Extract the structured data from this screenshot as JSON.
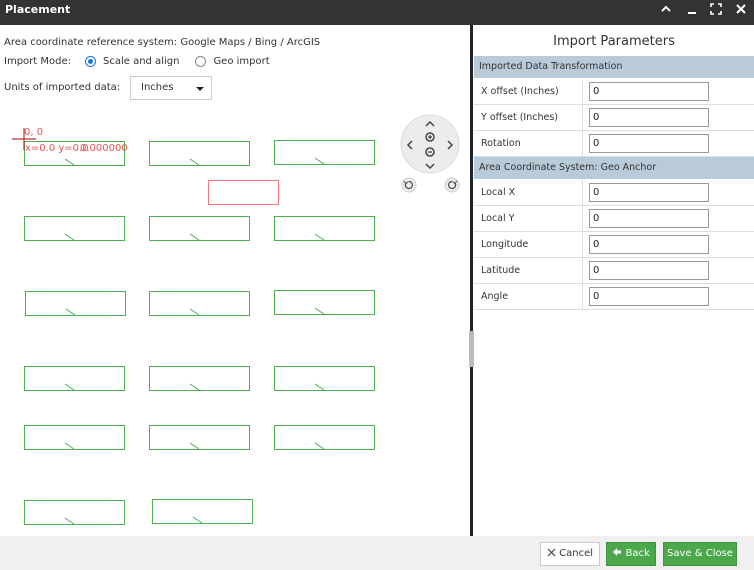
{
  "window": {
    "title": "Placement"
  },
  "left": {
    "crs_text": "Area coordinate reference system: Google Maps / Bing / ArcGIS",
    "import_mode_label": "Import Mode:",
    "mode_options": [
      "Scale and align",
      "Geo import"
    ],
    "selected_mode": "Scale and align",
    "units_label": "Units of imported data:",
    "units_value": "Inches",
    "origin_label": "0, 0",
    "coord_readout_overlap": "x=0.0 y=0.0",
    "coord_readout_value": "0.000000"
  },
  "right": {
    "title": "Import Parameters",
    "section1": "Imported Data Transformation",
    "x_offset_label": "X offset (Inches)",
    "x_offset_value": "0",
    "y_offset_label": "Y offset (Inches)",
    "y_offset_value": "0",
    "rotation_label": "Rotation",
    "rotation_value": "0",
    "section2": "Area Coordinate System: Geo Anchor",
    "local_x_label": "Local X",
    "local_x_value": "0",
    "local_y_label": "Local Y",
    "local_y_value": "0",
    "longitude_label": "Longitude",
    "longitude_value": "0",
    "latitude_label": "Latitude",
    "latitude_value": "0",
    "angle_label": "Angle",
    "angle_value": "0"
  },
  "footer": {
    "cancel_label": "Cancel",
    "back_label": "Back",
    "save_label": "Save & Close"
  },
  "colors": {
    "titlebar": "#333333",
    "section_header": "#b9cbd8",
    "shape_stroke": "#4caf50",
    "highlight_stroke": "#ef7a7a",
    "primary_button": "#4aa84a"
  },
  "icons": {
    "titlebar": [
      "chevron-up-icon",
      "minimize-icon",
      "expand-icon",
      "close-icon"
    ],
    "navigator": [
      "pan-up-icon",
      "pan-down-icon",
      "pan-left-icon",
      "pan-right-icon",
      "zoom-in-icon",
      "zoom-out-icon",
      "rotate-ccw-icon",
      "rotate-cw-icon"
    ],
    "footer": [
      "cancel-x-icon",
      "back-arrow-icon"
    ]
  }
}
